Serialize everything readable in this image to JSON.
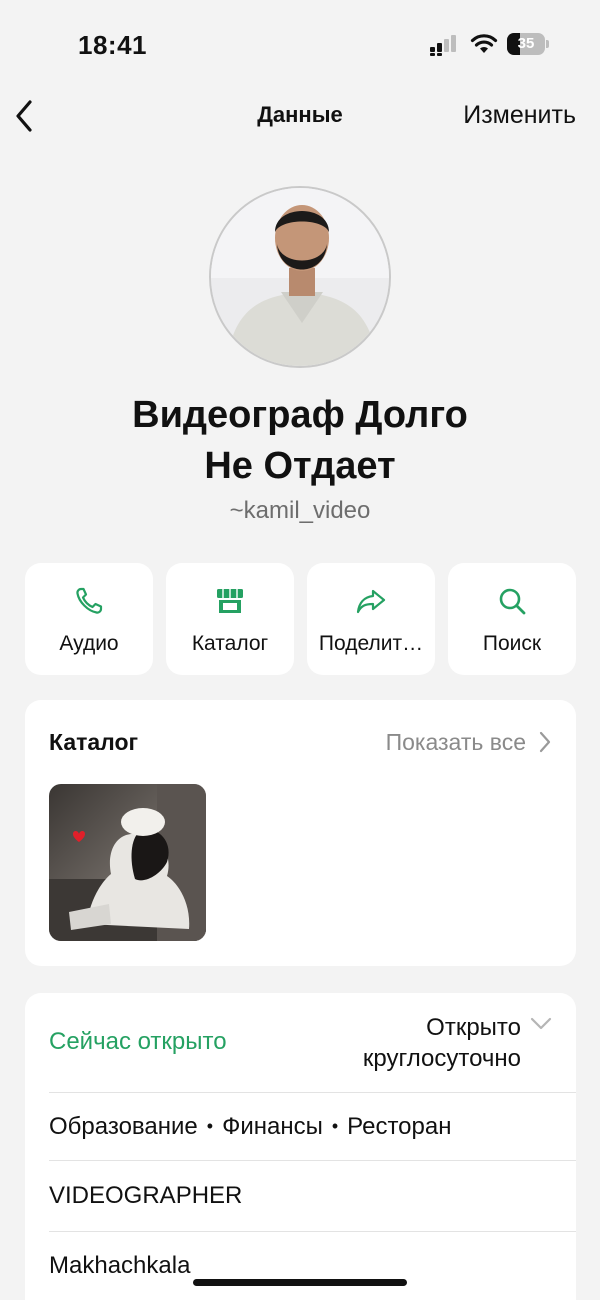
{
  "status_bar": {
    "time": "18:41",
    "battery_level": "35",
    "battery_fraction": 0.35,
    "signal_icon": "cellular-signal-icon",
    "wifi_icon": "wifi-icon"
  },
  "nav": {
    "back_icon": "chevron-left-icon",
    "title": "Данные",
    "edit_label": "Изменить"
  },
  "profile": {
    "name_line1": "Видеограф Долго",
    "name_line2": "Не Отдает",
    "username": "~kamil_video"
  },
  "actions": [
    {
      "label": "Аудио",
      "icon": "phone-icon"
    },
    {
      "label": "Каталог",
      "icon": "storefront-icon"
    },
    {
      "label": "Поделит…",
      "icon": "share-arrow-icon"
    },
    {
      "label": "Поиск",
      "icon": "search-icon"
    }
  ],
  "catalog": {
    "title": "Каталог",
    "show_all": "Показать все"
  },
  "business_info": {
    "status": "Сейчас открыто",
    "hours_line1": "Открыто",
    "hours_line2": "круглосуточно",
    "categories": [
      "Образование",
      "Финансы",
      "Ресторан"
    ],
    "description": "VIDEOGRAPHER",
    "city": "Makhachkala"
  },
  "colors": {
    "accent_green": "#25a162",
    "background": "#f3f3f3",
    "card": "#ffffff"
  }
}
